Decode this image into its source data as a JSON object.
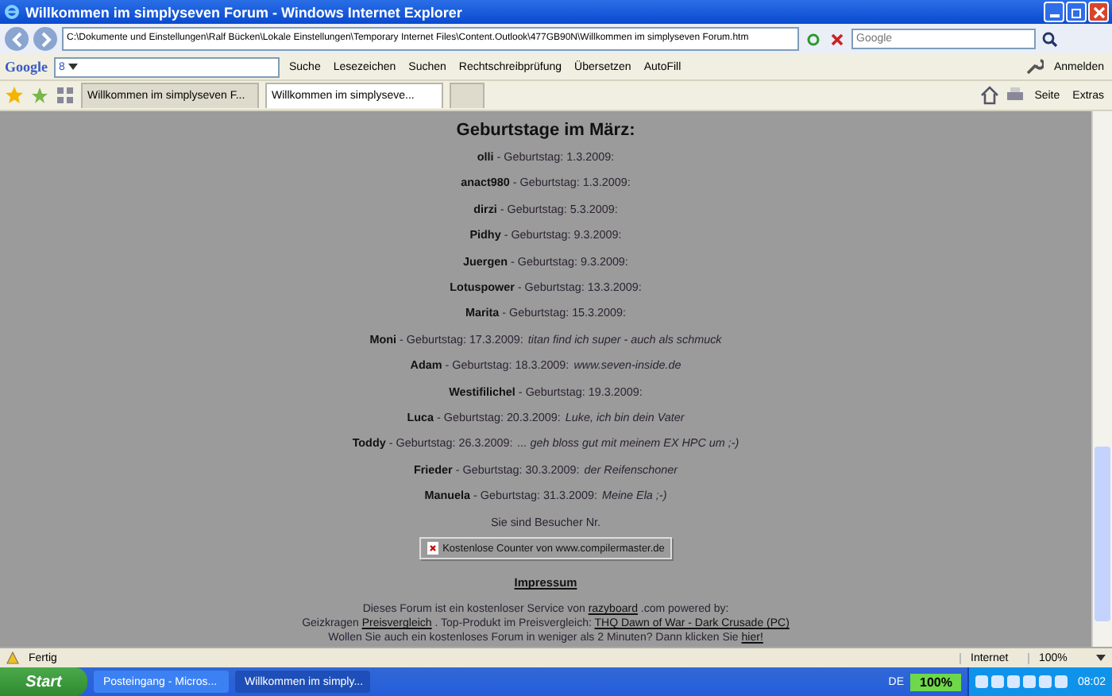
{
  "window": {
    "title": "Willkommen im simplyseven Forum - Windows Internet Explorer"
  },
  "address_bar": {
    "value": "C:\\Dokumente und Einstellungen\\Ralf Bücken\\Lokale Einstellungen\\Temporary Internet Files\\Content.Outlook\\477GB90N\\Willkommen im simplyseven Forum.htm",
    "search_placeholder": "Google"
  },
  "google_toolbar": {
    "logo": "Google",
    "search_menu": "8",
    "items": [
      {
        "label": "Suche"
      },
      {
        "label": "Lesezeichen"
      },
      {
        "label": "Suchen"
      },
      {
        "label": "Rechtschreibprüfung"
      },
      {
        "label": "Übersetzen"
      },
      {
        "label": "AutoFill"
      }
    ],
    "sign_in": "Anmelden"
  },
  "tabs": [
    {
      "label": "Willkommen im simplyseven F...",
      "selected": false
    },
    {
      "label": "Willkommen im simplyseve...",
      "selected": true
    }
  ],
  "command_bar": [
    "Seite",
    "Extras"
  ],
  "page": {
    "heading": "Geburtstage im März:",
    "birthdays": [
      {
        "name": "olli",
        "detail": "- Geburtstag: 1.3.2009:"
      },
      {
        "name": "anact980",
        "detail": "- Geburtstag: 1.3.2009:"
      },
      {
        "name": "dirzi",
        "detail": "- Geburtstag: 5.3.2009:"
      },
      {
        "name": "Pidhy",
        "detail": "- Geburtstag: 9.3.2009:"
      },
      {
        "name": "Juergen",
        "detail": "- Geburtstag: 9.3.2009:"
      },
      {
        "name": "Lotuspower",
        "detail": "- Geburtstag: 13.3.2009:"
      },
      {
        "name": "Marita",
        "detail": "- Geburtstag: 15.3.2009:"
      },
      {
        "name": "Moni",
        "detail": "- Geburtstag: 17.3.2009:",
        "note": "titan find ich super - auch als schmuck"
      },
      {
        "name": "Adam",
        "detail": "- Geburtstag: 18.3.2009:",
        "note": "www.seven-inside.de"
      },
      {
        "name": "Westifilichel",
        "detail": "- Geburtstag: 19.3.2009:"
      },
      {
        "name": "Luca",
        "detail": "- Geburtstag: 20.3.2009:",
        "note": "Luke, ich bin dein Vater"
      },
      {
        "name": "Toddy",
        "detail": "- Geburtstag: 26.3.2009:",
        "note": "... geh bloss gut mit meinem EX HPC um ;-)"
      },
      {
        "name": "Frieder",
        "detail": "- Geburtstag: 30.3.2009:",
        "note": "der Reifenschoner"
      },
      {
        "name": "Manuela",
        "detail": "- Geburtstag: 31.3.2009:",
        "note": "Meine Ela ;-)"
      }
    ],
    "visitor_label": "Sie sind Besucher Nr.",
    "counter_image_alt": "Kostenlose Counter von www.compilermaster.de",
    "imprint_link": "Impressum",
    "footer_lines": [
      [
        {
          "text": "Dieses Forum ist ein kostenloser Service von",
          "link": false
        },
        {
          "text": "razyboard",
          "link": true
        },
        {
          "text": ".com powered by:",
          "link": false
        }
      ],
      [
        {
          "text": "Geizkragen",
          "link": false
        },
        {
          "text": "Preisvergleich",
          "link": true
        },
        {
          "text": ". Top-Produkt im Preisvergleich:",
          "link": false
        },
        {
          "text": "THQ Dawn of War - Dark Crusade (PC)",
          "link": true
        }
      ],
      [
        {
          "text": "Wollen Sie auch ein kostenloses Forum in weniger als 2 Minuten? Dann klicken Sie",
          "link": false
        },
        {
          "text": "hier!",
          "link": true
        }
      ]
    ]
  },
  "status_bar": {
    "status": "Fertig",
    "zone": "Internet",
    "zoom": "100%"
  },
  "taskbar": {
    "start": "Start",
    "tasks": [
      {
        "label": "Posteingang - Micros...",
        "selected": false
      },
      {
        "label": "Willkommen im simply...",
        "selected": true
      }
    ],
    "language": "DE",
    "battery": "100%",
    "clock": "08:02"
  }
}
